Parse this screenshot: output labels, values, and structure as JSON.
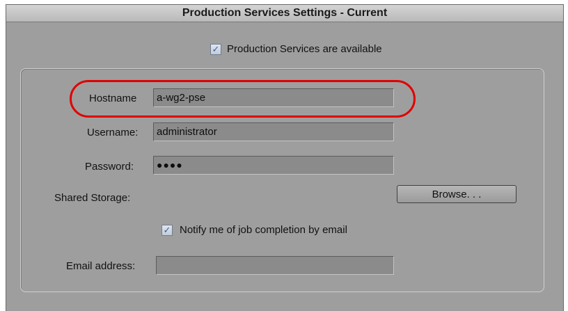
{
  "window": {
    "title": "Production Services Settings - Current"
  },
  "availability": {
    "checked": true,
    "label": "Production Services are available"
  },
  "fields": {
    "hostname_label": "Hostname",
    "hostname_value": "a-wg2-pse",
    "username_label": "Username:",
    "username_value": "administrator",
    "password_label": "Password:",
    "password_value": "●●●●",
    "shared_storage_label": "Shared Storage:",
    "browse_label": "Browse. . .",
    "notify_checked": true,
    "notify_label": "Notify me of job completion by email",
    "email_label": "Email address:",
    "email_value": ""
  },
  "annotation": {
    "highlight_color": "#e00000"
  }
}
